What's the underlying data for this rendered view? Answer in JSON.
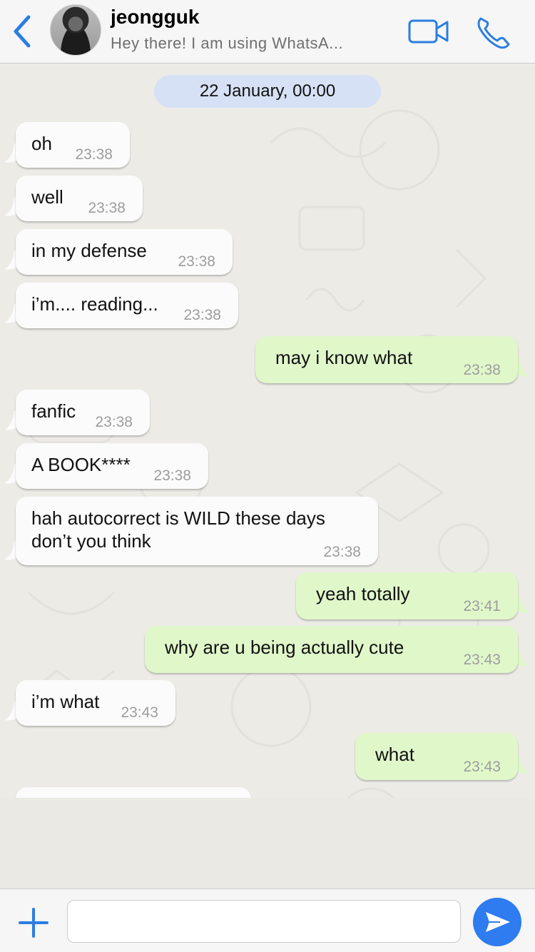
{
  "header": {
    "contact_name": "jeongguk",
    "status": "Hey there! I am using WhatsA...",
    "accent_color": "#2b7de1"
  },
  "chat": {
    "date_label": "22 January, 00:00",
    "messages": [
      {
        "dir": "in",
        "text": "oh",
        "time": "23:38"
      },
      {
        "dir": "in",
        "text": "well",
        "time": "23:38"
      },
      {
        "dir": "in",
        "text": "in my defense",
        "time": "23:38"
      },
      {
        "dir": "in",
        "text": "i’m.... reading...",
        "time": "23:38"
      },
      {
        "dir": "out",
        "text": "may i know what",
        "time": "23:38"
      },
      {
        "dir": "in",
        "text": "fanfic",
        "time": "23:38"
      },
      {
        "dir": "in",
        "text": "A BOOK****",
        "time": "23:38"
      },
      {
        "dir": "in",
        "text": "hah autocorrect is WILD these days\ndon’t you think",
        "time": "23:38"
      },
      {
        "dir": "out",
        "text": "yeah totally",
        "time": "23:41"
      },
      {
        "dir": "out",
        "text": "why are u being actually cute",
        "time": "23:43"
      },
      {
        "dir": "in",
        "text": "i’m what",
        "time": "23:43"
      },
      {
        "dir": "out",
        "text": "what",
        "time": "23:43"
      }
    ]
  },
  "input": {
    "value": "",
    "placeholder": ""
  },
  "icons": {
    "back": "chevron-left-icon",
    "video": "video-camera-icon",
    "call": "phone-icon",
    "attach": "plus-icon",
    "send": "send-icon"
  },
  "colors": {
    "incoming_bubble": "#fbfbfb",
    "outgoing_bubble": "#e0f7ca",
    "date_chip": "#d7e1f5",
    "send_button": "#2f7bf0"
  }
}
